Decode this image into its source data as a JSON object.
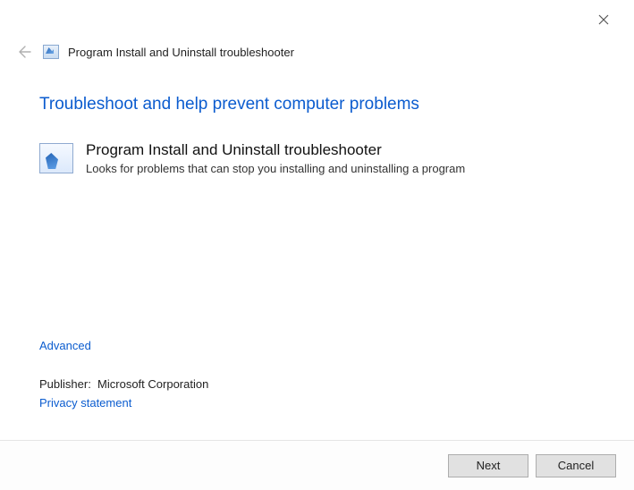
{
  "window": {
    "title": "Program Install and Uninstall troubleshooter"
  },
  "main": {
    "heading": "Troubleshoot and help prevent computer problems",
    "troubleshooter": {
      "title": "Program Install and Uninstall troubleshooter",
      "description": "Looks for problems that can stop you installing and uninstalling a program"
    }
  },
  "links": {
    "advanced": "Advanced",
    "privacy": "Privacy statement"
  },
  "publisher": {
    "label": "Publisher:",
    "value": "Microsoft Corporation"
  },
  "buttons": {
    "next": "Next",
    "cancel": "Cancel"
  }
}
